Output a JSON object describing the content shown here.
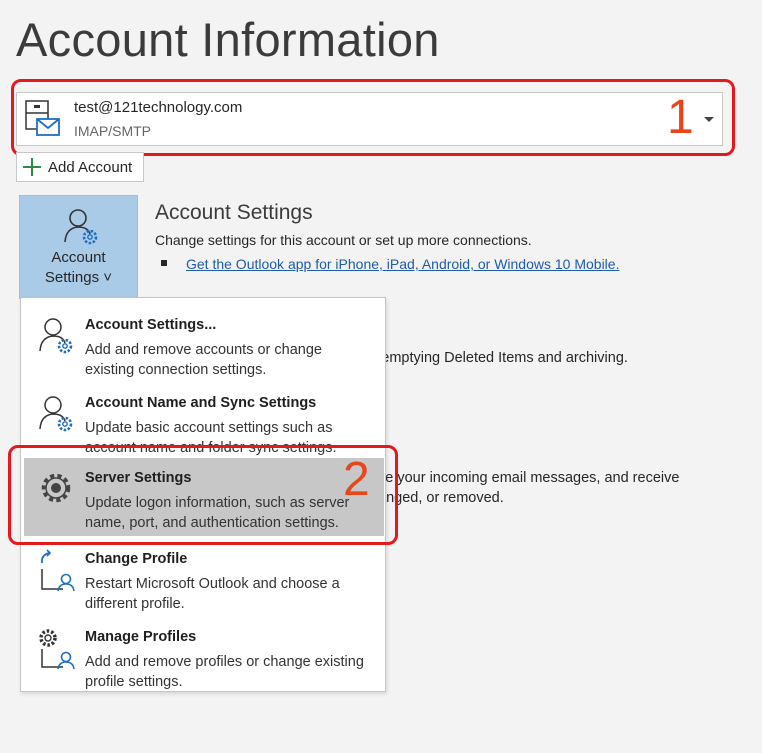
{
  "page": {
    "title": "Account Information"
  },
  "account": {
    "email": "test@121technology.com",
    "type": "IMAP/SMTP"
  },
  "annotations": {
    "first": "1",
    "second": "2"
  },
  "add_account": {
    "label": "Add Account"
  },
  "settings_tile": {
    "line1": "Account",
    "line2": "Settings ˅"
  },
  "account_settings_section": {
    "title": "Account Settings",
    "description": "Change settings for this account or set up more connections.",
    "link": "Get the Outlook app for iPhone, iPad, Android, or Windows 10 Mobile."
  },
  "background_text": {
    "line1": "y emptying Deleted Items and archiving.",
    "line2": "ze your incoming email messages, and receive",
    "line3": "anged, or removed."
  },
  "menu": {
    "items": [
      {
        "title": "Account Settings...",
        "desc": "Add and remove accounts or change existing connection settings.",
        "icon": "account-settings-icon"
      },
      {
        "title": "Account Name and Sync Settings",
        "desc": "Update basic account settings such as account name and folder sync settings.",
        "icon": "account-name-icon"
      },
      {
        "title": "Server Settings",
        "desc": "Update logon information, such as server name, port, and authentication settings.",
        "icon": "gear-icon"
      },
      {
        "title": "Change Profile",
        "desc": "Restart Microsoft Outlook and choose a different profile.",
        "icon": "change-profile-icon"
      },
      {
        "title": "Manage Profiles",
        "desc": "Add and remove profiles or change existing profile settings.",
        "icon": "manage-profiles-icon"
      }
    ]
  },
  "colors": {
    "annotation_red": "#e5181e",
    "tile_blue": "#a9cbe8",
    "highlight_gray": "#c7c7c7",
    "link_blue": "#1e5ba8"
  }
}
